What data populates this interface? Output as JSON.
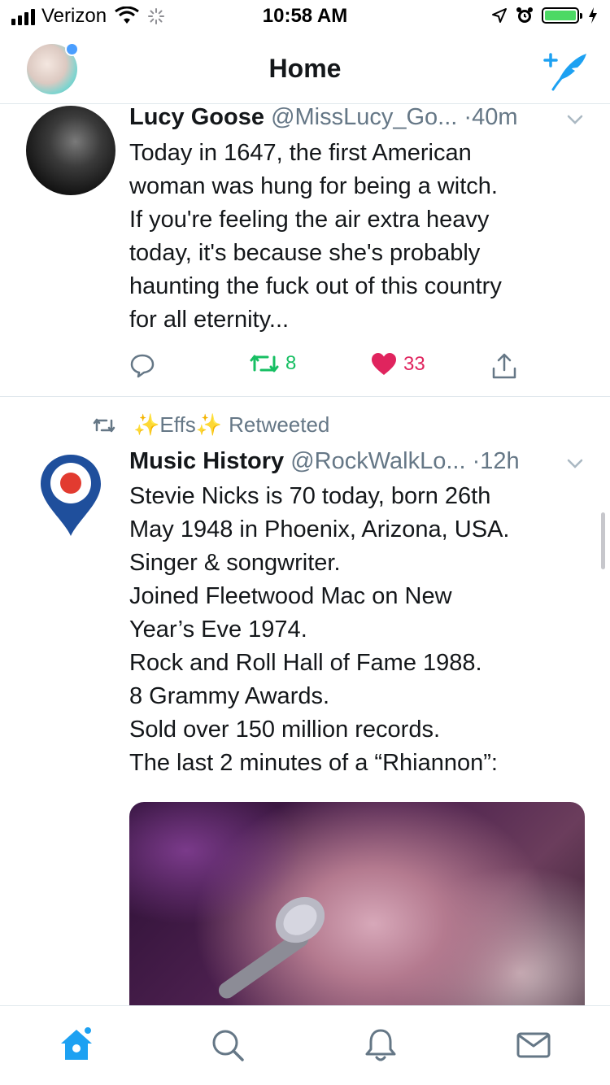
{
  "status_bar": {
    "carrier": "Verizon",
    "time": "10:58 AM"
  },
  "nav": {
    "title": "Home"
  },
  "colors": {
    "brand_blue": "#1da1f2",
    "retweet_green": "#17bf63",
    "like_red": "#e0245e",
    "meta_gray": "#657786"
  },
  "tweets": [
    {
      "name": "Lucy Goose",
      "handle": "@MissLucy_Go...",
      "time": "·40m",
      "text": "Today in 1647, the first American\nwoman was hung for being a witch.\nIf you're feeling the air extra heavy\ntoday, it's because she's probably\nhaunting the fuck out of this country\nfor all eternity...",
      "retweets": "8",
      "likes": "33"
    },
    {
      "retweeted_by": "Effs",
      "retweeted_label": "Retweeted",
      "name": "Music History",
      "handle": "@RockWalkLo...",
      "time": "·12h",
      "text": "Stevie Nicks is 70 today, born 26th\nMay 1948 in Phoenix, Arizona, USA.\nSinger & songwriter.\nJoined Fleetwood Mac on New\nYear’s Eve 1974.\nRock and Roll Hall of Fame 1988.\n8 Grammy Awards.\nSold over 150 million records.\nThe last 2 minutes of a “Rhiannon”:"
    }
  ],
  "tab_bar": {
    "icons": [
      "home-icon",
      "search-icon",
      "bell-icon",
      "envelope-icon"
    ]
  }
}
